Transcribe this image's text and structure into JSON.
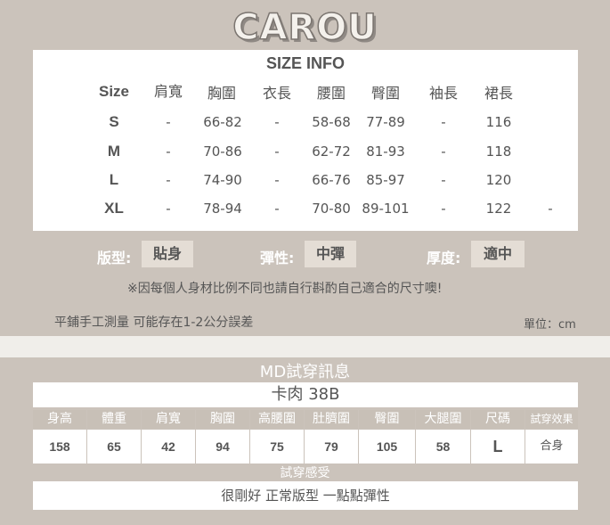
{
  "brand": {
    "logo_text": "CAROU"
  },
  "size_table": {
    "title": "SIZE INFO",
    "headers": [
      "Size",
      "肩寬",
      "胸圍",
      "衣長",
      "腰圍",
      "臀圍",
      "袖長",
      "裙長"
    ],
    "rows": [
      [
        "S",
        "-",
        "66-82",
        "-",
        "58-68",
        "77-89",
        "-",
        "116"
      ],
      [
        "M",
        "-",
        "70-86",
        "-",
        "62-72",
        "81-93",
        "-",
        "118"
      ],
      [
        "L",
        "-",
        "74-90",
        "-",
        "66-76",
        "85-97",
        "-",
        "120"
      ],
      [
        "XL",
        "-",
        "78-94",
        "-",
        "70-80",
        "89-101",
        "-",
        "122",
        "-"
      ]
    ]
  },
  "attributes": [
    {
      "label": "版型:",
      "value": "貼身"
    },
    {
      "label": "彈性:",
      "value": "中彈"
    },
    {
      "label": "厚度:",
      "value": "適中"
    }
  ],
  "note": "※因每個人身材比例不同也請自行斟酌自己適合的尺寸噢!",
  "measure_note": "平鋪手工測量 可能存在1-2公分誤差",
  "unit": "單位：cm",
  "model": {
    "section_title": "MD試穿訊息",
    "name": "卡肉 38B",
    "headers": [
      "身高",
      "體重",
      "肩寬",
      "胸圍",
      "高腰圍",
      "肚臍圍",
      "臀圍",
      "大腿圍",
      "尺碼",
      "試穿效果"
    ],
    "values": [
      "158",
      "65",
      "42",
      "94",
      "75",
      "79",
      "105",
      "58",
      "L",
      "合身"
    ],
    "feel_title": "試穿感受",
    "feel_text": "很剛好 正常版型 一點點彈性"
  }
}
